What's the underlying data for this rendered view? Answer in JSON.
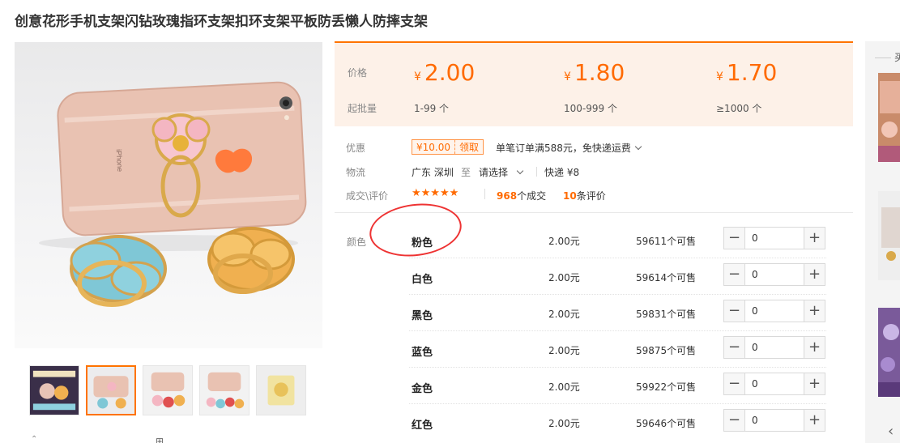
{
  "product": {
    "title": "创意花形手机支架闪钻玫瑰指环支架扣环支架平板防丢懒人防摔支架"
  },
  "gallery": {
    "phone_logo_text": "iPhone",
    "thumbnail_count": 5,
    "active_thumbnail": 2,
    "bottom_glyphs": [
      "⌃",
      "⊞"
    ]
  },
  "pricing": {
    "price_label": "价格",
    "moq_label": "起批量",
    "currency": "¥",
    "tiers": [
      {
        "price": "2.00",
        "range": "1-99 个"
      },
      {
        "price": "1.80",
        "range": "100-999 个"
      },
      {
        "price": "1.70",
        "range": "≥1000 个"
      }
    ]
  },
  "promo": {
    "label": "优惠",
    "coupon_value": "¥10.00",
    "coupon_claim": "领取",
    "offer_text": "单笔订单满588元，免快递运费"
  },
  "logistics": {
    "label": "物流",
    "origin": "广东 深圳",
    "to": "至",
    "destination": "请选择",
    "shipping": "快递 ¥8"
  },
  "rating": {
    "label": "成交\\评价",
    "stars": "★★★★★",
    "deals_count": "968",
    "deals_suffix": "个成交",
    "reviews_count": "10",
    "reviews_suffix": "条评价"
  },
  "sku": {
    "label": "颜色",
    "rows": [
      {
        "name": "粉色",
        "price": "2.00元",
        "stock": "59611个可售",
        "qty": "0"
      },
      {
        "name": "白色",
        "price": "2.00元",
        "stock": "59614个可售",
        "qty": "0"
      },
      {
        "name": "黑色",
        "price": "2.00元",
        "stock": "59831个可售",
        "qty": "0"
      },
      {
        "name": "蓝色",
        "price": "2.00元",
        "stock": "59875个可售",
        "qty": "0"
      },
      {
        "name": "金色",
        "price": "2.00元",
        "stock": "59922个可售",
        "qty": "0"
      },
      {
        "name": "红色",
        "price": "2.00元",
        "stock": "59646个可售",
        "qty": "0"
      }
    ]
  },
  "sidebar": {
    "heading": "买",
    "prev_arrow": "‹"
  },
  "colors": {
    "accent": "#ff6a00",
    "price_bg": "#fdf1e8",
    "annotation": "#ee3333"
  }
}
